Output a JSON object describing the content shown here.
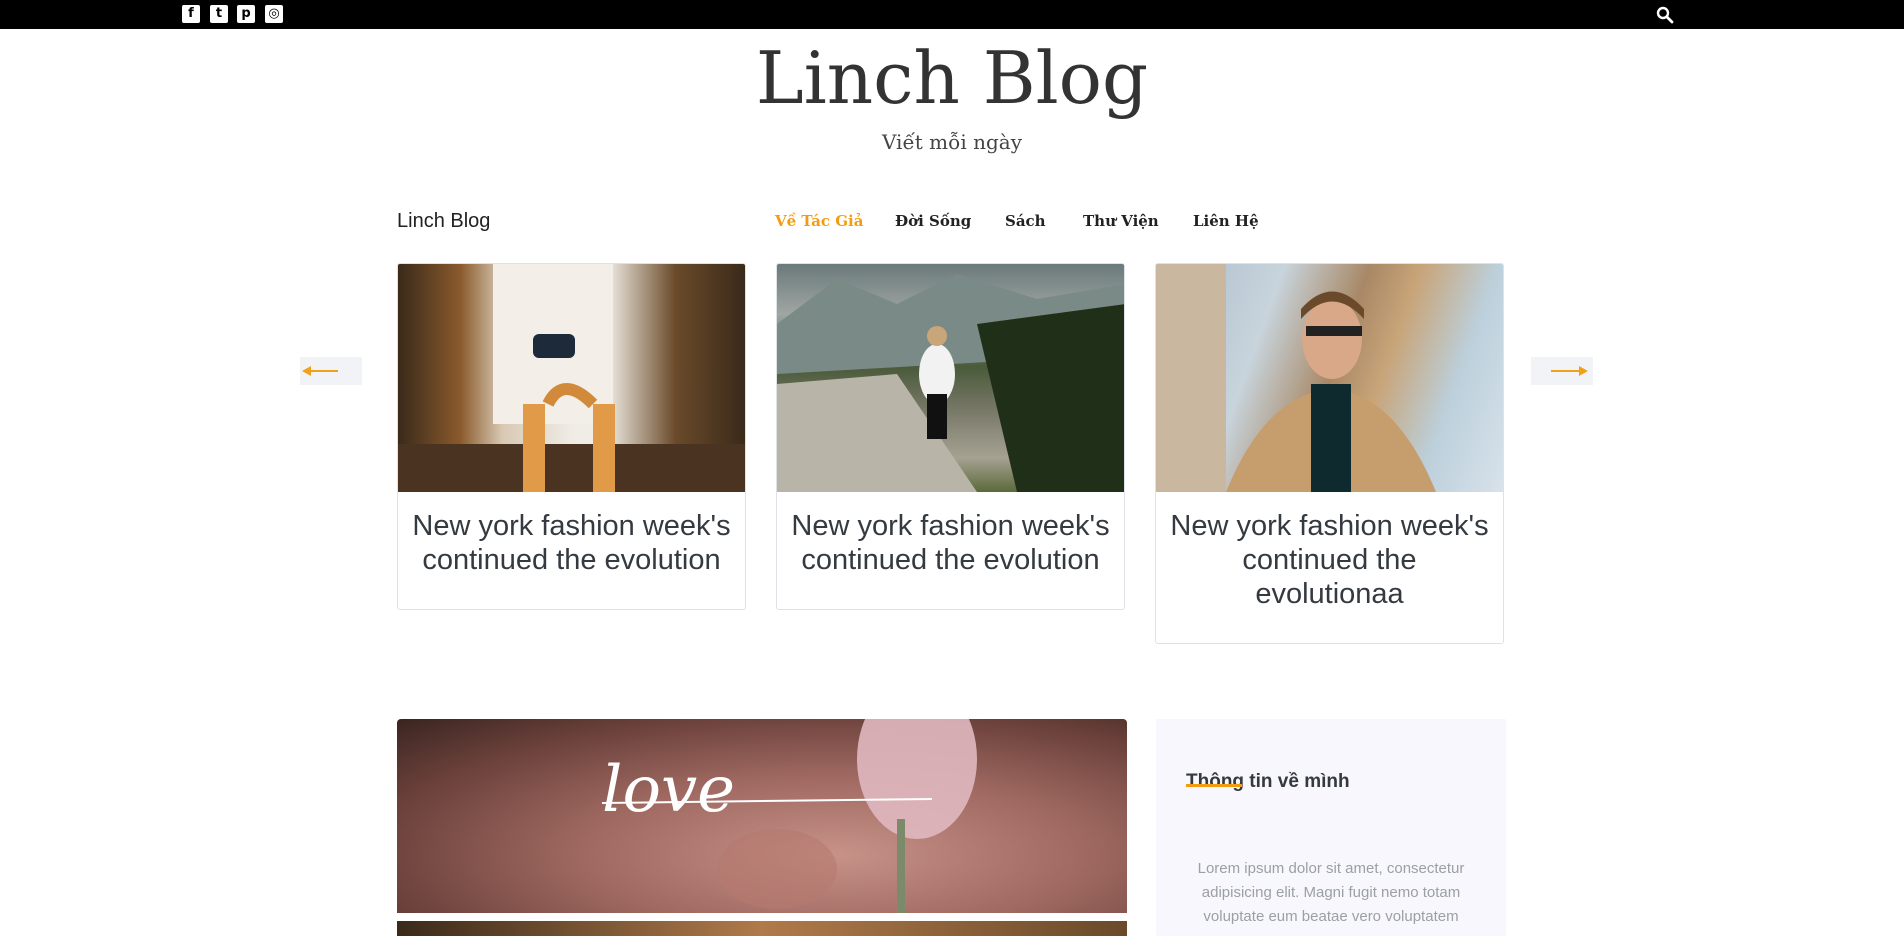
{
  "topbar": {
    "social": [
      {
        "name": "facebook-icon",
        "glyph": "f"
      },
      {
        "name": "twitter-icon",
        "glyph": "t"
      },
      {
        "name": "pinterest-icon",
        "glyph": "p"
      },
      {
        "name": "instagram-icon",
        "glyph": "◎"
      }
    ],
    "search_icon": "search-icon"
  },
  "header": {
    "title": "Linch Blog",
    "tagline": "Viết mỗi ngày"
  },
  "nav": {
    "brand": "Linch Blog",
    "items": [
      {
        "label": "Về Tác Giả",
        "active": true
      },
      {
        "label": "Đời Sống",
        "active": false
      },
      {
        "label": "Sách",
        "active": false
      },
      {
        "label": "Thư Viện",
        "active": false
      },
      {
        "label": "Liên Hệ",
        "active": false
      }
    ],
    "accent_color": "#f39c12"
  },
  "carousel": {
    "prev_icon": "arrow-left-icon",
    "next_icon": "arrow-right-icon",
    "cards": [
      {
        "title": "New york fashion week's continued the evolution"
      },
      {
        "title": "New york fashion week's continued the evolution"
      },
      {
        "title": "New york fashion week's continued the evolutionaa"
      }
    ]
  },
  "featured": {
    "overlay_text": "love"
  },
  "sidebar": {
    "title": "Thông tin về mình",
    "text": "Lorem ipsum dolor sit amet, consectetur adipisicing elit. Magni fugit nemo totam voluptate eum beatae vero voluptatem"
  }
}
